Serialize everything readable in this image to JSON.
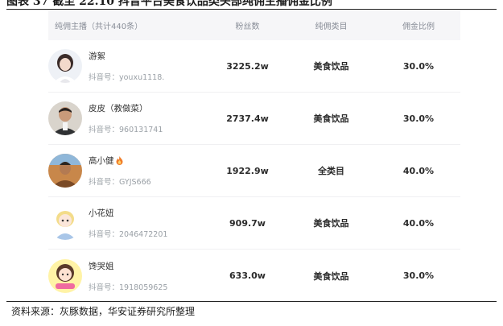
{
  "figure": {
    "title": "图表 37 截至 22.10 抖音平台美食饮品类头部纯佣主播佣金比例",
    "source": "资料来源：灰豚数据，华安证券研究所整理"
  },
  "table": {
    "headers": {
      "host": "纯佣主播（共计440条）",
      "fans": "粉丝数",
      "category": "纯佣类目",
      "rate": "佣金比例"
    },
    "rows": [
      {
        "name": "游絮",
        "badge_icon": "",
        "id": "抖音号：youxu1118.",
        "fans": "3225.2w",
        "category": "美食饮品",
        "rate": "30.0%"
      },
      {
        "name": "皮皮（教做菜）",
        "badge_icon": "",
        "id": "抖音号：960131741",
        "fans": "2737.4w",
        "category": "美食饮品",
        "rate": "30.0%"
      },
      {
        "name": "高小健",
        "badge_icon": "fire-icon",
        "id": "抖音号：GYJS666",
        "fans": "1922.9w",
        "category": "全类目",
        "rate": "40.0%"
      },
      {
        "name": "小花妞",
        "badge_icon": "",
        "id": "抖音号：2046472201",
        "fans": "909.7w",
        "category": "美食饮品",
        "rate": "40.0%"
      },
      {
        "name": "馋哭姐",
        "badge_icon": "",
        "id": "抖音号：1918059625",
        "fans": "633.0w",
        "category": "美食饮品",
        "rate": "30.0%"
      }
    ]
  },
  "colors": {
    "header_bg": "#f6f6f8",
    "header_text": "#8a8f99",
    "fire": "#f07d2a"
  }
}
